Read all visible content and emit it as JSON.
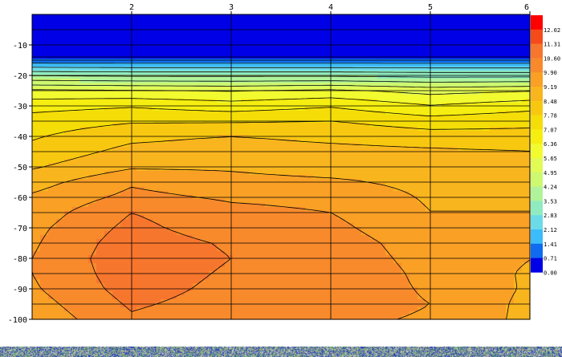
{
  "chart_data": {
    "type": "heatmap",
    "title": "",
    "xlabel": "",
    "ylabel": "",
    "x_ticks": [
      2,
      3,
      4,
      5,
      6
    ],
    "y_ticks": [
      -10,
      -20,
      -30,
      -40,
      -50,
      -60,
      -70,
      -80,
      -90,
      -100
    ],
    "xlim": [
      1,
      6
    ],
    "ylim": [
      -100,
      0
    ],
    "grid": true,
    "colorbar": {
      "levels": [
        "12.02",
        "11.31",
        "10.60",
        "9.90",
        "9.19",
        "8.48",
        "7.78",
        "7.07",
        "6.36",
        "5.65",
        "4.95",
        "4.24",
        "3.53",
        "2.83",
        "2.12",
        "1.41",
        "0.71",
        "0.00"
      ],
      "colors": [
        "#ff0000",
        "#f54a1a",
        "#f7762e",
        "#f88a2c",
        "#f9a025",
        "#f9b51e",
        "#f8c810",
        "#f5dd08",
        "#f5ee10",
        "#f2fa30",
        "#e2fa55",
        "#cdf870",
        "#b0f39a",
        "#90ebc0",
        "#6cdbe8",
        "#3cbcfa",
        "#0f6cf0",
        "#0000e6"
      ]
    },
    "columns_x": [
      1,
      2,
      3,
      4,
      5,
      6
    ],
    "depths": [
      0,
      -5,
      -10,
      -15,
      -20,
      -25,
      -30,
      -35,
      -40,
      -45,
      -50,
      -55,
      -60,
      -65,
      -70,
      -75,
      -80,
      -85,
      -90,
      -95,
      -100
    ],
    "values": [
      [
        0.0,
        0.0,
        0.0,
        0.0,
        0.0,
        0.0
      ],
      [
        0.0,
        0.0,
        0.0,
        0.0,
        0.0,
        0.0
      ],
      [
        0.0,
        0.0,
        0.0,
        0.0,
        0.0,
        0.0
      ],
      [
        0.9,
        0.9,
        0.9,
        0.9,
        0.9,
        0.9
      ],
      [
        3.5,
        3.4,
        3.4,
        3.4,
        3.3,
        3.3
      ],
      [
        5.8,
        5.7,
        5.6,
        5.8,
        5.4,
        5.6
      ],
      [
        6.8,
        7.0,
        6.7,
        7.0,
        6.4,
        6.8
      ],
      [
        7.4,
        7.7,
        7.7,
        7.8,
        7.4,
        7.6
      ],
      [
        7.7,
        8.3,
        8.5,
        8.3,
        8.1,
        8.0
      ],
      [
        8.0,
        8.7,
        8.8,
        8.7,
        8.6,
        8.5
      ],
      [
        8.4,
        9.1,
        9.1,
        8.9,
        8.9,
        8.8
      ],
      [
        8.9,
        9.8,
        9.4,
        9.3,
        9.0,
        9.0
      ],
      [
        9.3,
        10.1,
        9.8,
        9.7,
        9.1,
        9.1
      ],
      [
        9.5,
        10.6,
        10.1,
        9.9,
        9.2,
        9.2
      ],
      [
        9.7,
        10.8,
        10.2,
        10.1,
        9.3,
        9.3
      ],
      [
        9.8,
        11.0,
        10.5,
        10.3,
        9.5,
        9.8
      ],
      [
        9.9,
        11.1,
        10.6,
        10.4,
        9.6,
        9.2
      ],
      [
        9.9,
        11.0,
        10.5,
        10.5,
        9.7,
        9.1
      ],
      [
        9.8,
        10.9,
        10.4,
        10.4,
        9.8,
        9.1
      ],
      [
        9.6,
        10.7,
        10.3,
        10.3,
        9.9,
        9.0
      ],
      [
        9.4,
        10.5,
        10.1,
        10.1,
        9.8,
        9.0
      ]
    ]
  }
}
